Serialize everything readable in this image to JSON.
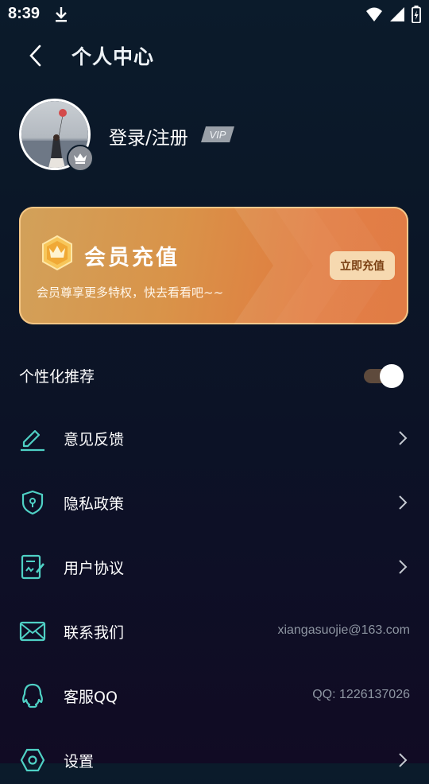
{
  "status_bar": {
    "time": "8:39"
  },
  "header": {
    "title": "个人中心"
  },
  "profile": {
    "login_label": "登录/注册",
    "vip_tag": "VIP"
  },
  "vip_card": {
    "title": "会员充值",
    "subtitle": "会员尊享更多特权，快去看看吧~~",
    "button_label": "立即充值"
  },
  "toggle": {
    "label": "个性化推荐",
    "enabled": true
  },
  "menu": [
    {
      "label": "意见反馈",
      "icon": "edit-icon",
      "arrow": true
    },
    {
      "label": "隐私政策",
      "icon": "shield-icon",
      "arrow": true
    },
    {
      "label": "用户协议",
      "icon": "document-icon",
      "arrow": true
    },
    {
      "label": "联系我们",
      "icon": "mail-icon",
      "value": "xiangasuojie@163.com"
    },
    {
      "label": "客服QQ",
      "icon": "qq-icon",
      "value": "QQ: 1226137026"
    },
    {
      "label": "设置",
      "icon": "settings-icon",
      "arrow": true
    }
  ],
  "colors": {
    "accent_teal": "#4fd1c5",
    "vip_gold": "#d9984a",
    "toggle_track": "#5e4a3c"
  }
}
